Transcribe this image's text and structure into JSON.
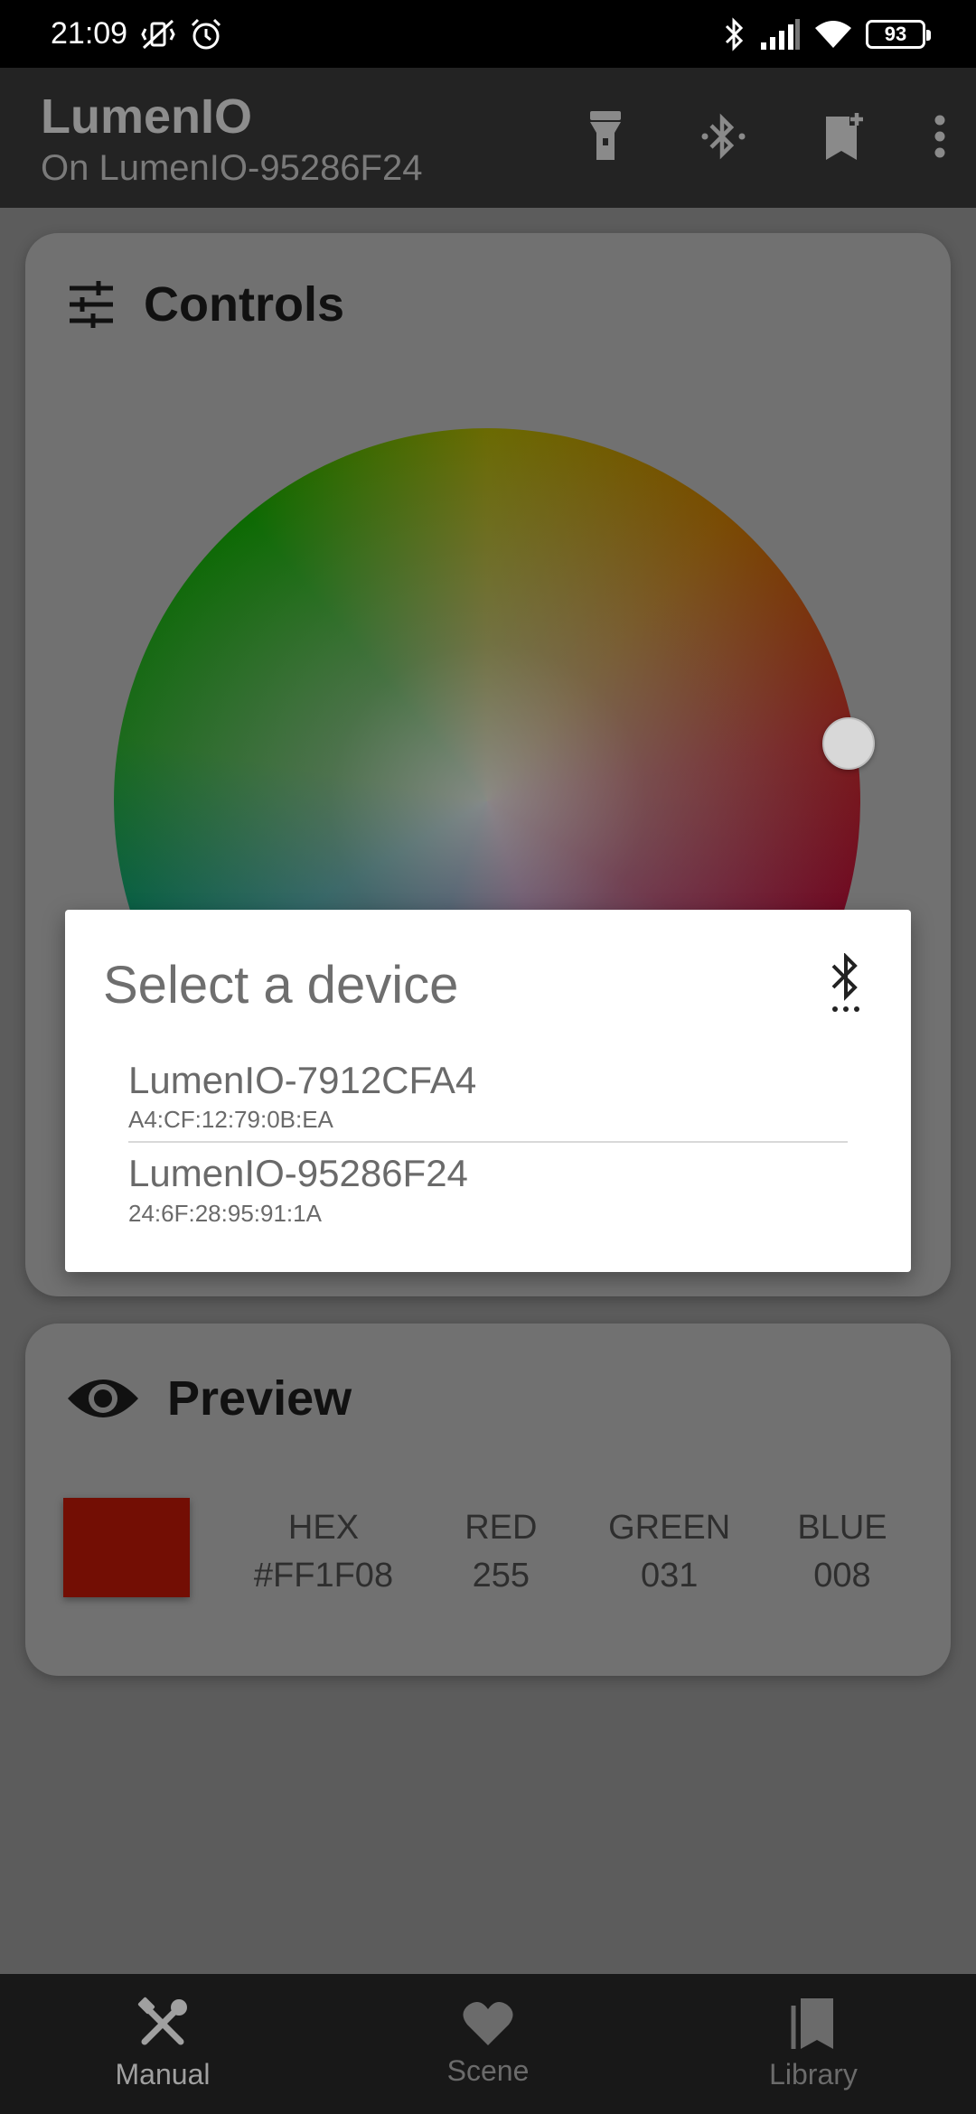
{
  "status_bar": {
    "time": "21:09",
    "battery": "93",
    "icons_left": [
      "mute-vibrate-icon",
      "alarm-icon"
    ],
    "icons_right": [
      "bluetooth-icon",
      "signal-icon",
      "wifi-icon",
      "battery-icon"
    ]
  },
  "app_bar": {
    "title": "LumenIO",
    "subtitle": "On LumenIO-95286F24",
    "actions": [
      "flashlight-icon",
      "bluetooth-searching-icon",
      "bookmark-add-icon",
      "more-vert-icon"
    ]
  },
  "controls_card": {
    "title": "Controls",
    "icon": "tune-icon"
  },
  "preview_card": {
    "title": "Preview",
    "icon": "eye-icon",
    "swatch_color": "#FF1F08",
    "stats": [
      {
        "label": "HEX",
        "value": "#FF1F08"
      },
      {
        "label": "RED",
        "value": "255"
      },
      {
        "label": "GREEN",
        "value": "031"
      },
      {
        "label": "BLUE",
        "value": "008"
      }
    ]
  },
  "dialog": {
    "title": "Select a device",
    "icon": "bluetooth-searching-icon",
    "devices": [
      {
        "name": "LumenIO-7912CFA4",
        "mac": "A4:CF:12:79:0B:EA"
      },
      {
        "name": "LumenIO-95286F24",
        "mac": "24:6F:28:95:91:1A"
      }
    ]
  },
  "bottom_nav": {
    "items": [
      {
        "label": "Manual",
        "icon": "tools-icon",
        "active": true
      },
      {
        "label": "Scene",
        "icon": "heart-icon",
        "active": false
      },
      {
        "label": "Library",
        "icon": "library-icon",
        "active": false
      }
    ]
  }
}
